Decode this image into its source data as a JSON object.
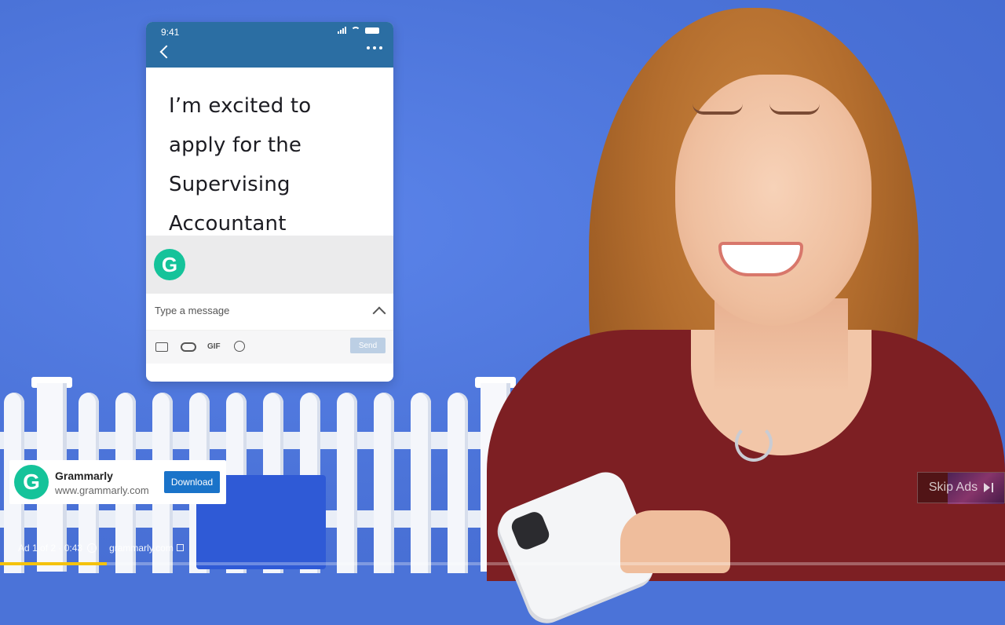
{
  "phone": {
    "status_time": "9:41",
    "message_text": "I’m excited to apply for the Supervising Accountant position.",
    "compose_placeholder": "Type a message",
    "toolbar_gif_label": "GIF",
    "send_label": "Send",
    "grammarly_logo_letter": "G"
  },
  "ad_card": {
    "logo_letter": "G",
    "title": "Grammarly",
    "url": "www.grammarly.com",
    "download_label": "Download"
  },
  "skip": {
    "label": "Skip Ads"
  },
  "ad_info": {
    "position": "Ad 1 of 2 · 0:43",
    "info_symbol": "i",
    "domain": "grammarly.com"
  },
  "progress": {
    "fraction": 0.106
  },
  "colors": {
    "background": "#4b73d8",
    "phone_header": "#2b6ea3",
    "grammarly_green": "#15c39a",
    "download_blue": "#1a73c9",
    "progress_yellow": "#f4c20d",
    "shirt": "#7d1f23"
  },
  "icons": [
    "back-icon",
    "more-icon",
    "signal-icon",
    "wifi-icon",
    "battery-icon",
    "chevron-up-icon",
    "image-icon",
    "attach-icon",
    "gif-icon",
    "emoji-icon",
    "info-icon",
    "external-link-icon",
    "skip-next-icon"
  ]
}
